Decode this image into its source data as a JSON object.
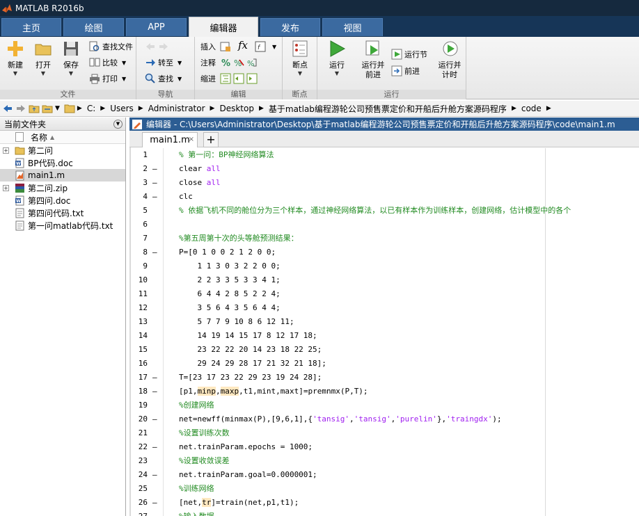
{
  "window": {
    "title": "MATLAB R2016b"
  },
  "tabs": [
    {
      "label": "主页",
      "active": false
    },
    {
      "label": "绘图",
      "active": false
    },
    {
      "label": "APP",
      "active": false
    },
    {
      "label": "编辑器",
      "active": true
    },
    {
      "label": "发布",
      "active": false
    },
    {
      "label": "视图",
      "active": false
    }
  ],
  "ribbon": {
    "file": {
      "group_label": "文件",
      "new": "新建",
      "open": "打开",
      "save": "保存",
      "find_files": "查找文件",
      "compare": "比较",
      "print": "打印"
    },
    "navigate": {
      "group_label": "导航",
      "goto": "转至",
      "find": "查找"
    },
    "edit": {
      "group_label": "编辑",
      "insert": "插入",
      "comment": "注释",
      "indent": "缩进",
      "fx": "fx"
    },
    "breakpoints": {
      "group_label": "断点",
      "breakpoints": "断点"
    },
    "run": {
      "group_label": "运行",
      "run": "运行",
      "run_advance_1": "运行并",
      "run_advance_2": "前进",
      "run_section": "运行节",
      "advance": "前进",
      "run_time_1": "运行并",
      "run_time_2": "计时"
    }
  },
  "address": {
    "crumbs": [
      "C:",
      "Users",
      "Administrator",
      "Desktop",
      "基于matlab编程游轮公司预售票定价和开船后升舱方案源码程序",
      "code"
    ]
  },
  "current_folder": {
    "title": "当前文件夹",
    "column_name": "名称",
    "files": [
      {
        "name": "第二问",
        "type": "folder",
        "expandable": true,
        "selected": false
      },
      {
        "name": "BP代码.doc",
        "type": "doc",
        "expandable": false,
        "selected": false
      },
      {
        "name": "main1.m",
        "type": "m",
        "expandable": false,
        "selected": true
      },
      {
        "name": "第二问.zip",
        "type": "zip",
        "expandable": true,
        "selected": false
      },
      {
        "name": "第四问.doc",
        "type": "doc",
        "expandable": false,
        "selected": false
      },
      {
        "name": "第四问代码.txt",
        "type": "txt",
        "expandable": false,
        "selected": false
      },
      {
        "name": "第一问matlab代码.txt",
        "type": "txt",
        "expandable": false,
        "selected": false
      }
    ]
  },
  "editor": {
    "title": "编辑器 - C:\\Users\\Administrator\\Desktop\\基于matlab编程游轮公司预售票定价和开船后升舱方案源码程序\\code\\main1.m",
    "tab_label": "main1.m",
    "tab_close": "×",
    "new_tab": "+",
    "lines": [
      {
        "n": "1",
        "dash": "",
        "segs": [
          {
            "t": "% 第一问：BP神经网络算法",
            "c": "com"
          }
        ]
      },
      {
        "n": "2",
        "dash": "–",
        "segs": [
          {
            "t": "clear ",
            "c": ""
          },
          {
            "t": "all",
            "c": "str"
          }
        ]
      },
      {
        "n": "3",
        "dash": "–",
        "segs": [
          {
            "t": "close ",
            "c": ""
          },
          {
            "t": "all",
            "c": "str"
          }
        ]
      },
      {
        "n": "4",
        "dash": "–",
        "segs": [
          {
            "t": "clc",
            "c": ""
          }
        ]
      },
      {
        "n": "5",
        "dash": "",
        "segs": [
          {
            "t": "% 依据飞机不同的舱位分为三个样本，通过神经网络算法，以已有样本作为训练样本，创建网络，估计模型中的各个",
            "c": "com"
          }
        ]
      },
      {
        "n": "6",
        "dash": "",
        "segs": [
          {
            "t": "",
            "c": ""
          }
        ]
      },
      {
        "n": "7",
        "dash": "",
        "segs": [
          {
            "t": "%第五周第十次的头等舱预测结果：",
            "c": "com"
          }
        ]
      },
      {
        "n": "8",
        "dash": "–",
        "segs": [
          {
            "t": "P=[0 1 0 0 2 1 2 0 0;",
            "c": ""
          }
        ]
      },
      {
        "n": "9",
        "dash": "",
        "segs": [
          {
            "t": "    1 1 3 0 3 2 2 0 0;",
            "c": ""
          }
        ]
      },
      {
        "n": "10",
        "dash": "",
        "segs": [
          {
            "t": "    2 2 3 3 5 3 3 4 1;",
            "c": ""
          }
        ]
      },
      {
        "n": "11",
        "dash": "",
        "segs": [
          {
            "t": "    6 4 4 2 8 5 2 2 4;",
            "c": ""
          }
        ]
      },
      {
        "n": "12",
        "dash": "",
        "segs": [
          {
            "t": "    3 5 6 4 3 5 6 4 4;",
            "c": ""
          }
        ]
      },
      {
        "n": "13",
        "dash": "",
        "segs": [
          {
            "t": "    5 7 7 9 10 8 6 12 11;",
            "c": ""
          }
        ]
      },
      {
        "n": "14",
        "dash": "",
        "segs": [
          {
            "t": "    14 19 14 15 17 8 12 17 18;",
            "c": ""
          }
        ]
      },
      {
        "n": "15",
        "dash": "",
        "segs": [
          {
            "t": "    23 22 22 20 14 23 18 22 25;",
            "c": ""
          }
        ]
      },
      {
        "n": "16",
        "dash": "",
        "segs": [
          {
            "t": "    29 24 29 28 17 21 32 21 18];",
            "c": ""
          }
        ]
      },
      {
        "n": "17",
        "dash": "–",
        "segs": [
          {
            "t": "T=[23 17 23 22 29 23 19 24 28];",
            "c": ""
          }
        ]
      },
      {
        "n": "18",
        "dash": "–",
        "segs": [
          {
            "t": "[p1,",
            "c": ""
          },
          {
            "t": "minp",
            "c": "hl"
          },
          {
            "t": ",",
            "c": ""
          },
          {
            "t": "maxp",
            "c": "hl"
          },
          {
            "t": ",t1,mint,maxt]=premnmx(P,T);",
            "c": ""
          }
        ]
      },
      {
        "n": "19",
        "dash": "",
        "segs": [
          {
            "t": "%创建网络",
            "c": "com"
          }
        ]
      },
      {
        "n": "20",
        "dash": "–",
        "segs": [
          {
            "t": "net=newff(minmax(P),[9,6,1],{",
            "c": ""
          },
          {
            "t": "'tansig'",
            "c": "str"
          },
          {
            "t": ",",
            "c": ""
          },
          {
            "t": "'tansig'",
            "c": "str"
          },
          {
            "t": ",",
            "c": ""
          },
          {
            "t": "'purelin'",
            "c": "str"
          },
          {
            "t": "},",
            "c": ""
          },
          {
            "t": "'traingdx'",
            "c": "str"
          },
          {
            "t": ");",
            "c": ""
          }
        ]
      },
      {
        "n": "21",
        "dash": "",
        "segs": [
          {
            "t": "%设置训练次数",
            "c": "com"
          }
        ]
      },
      {
        "n": "22",
        "dash": "–",
        "segs": [
          {
            "t": "net.trainParam.epochs = 1000;",
            "c": ""
          }
        ]
      },
      {
        "n": "23",
        "dash": "",
        "segs": [
          {
            "t": "%设置收敛误差",
            "c": "com"
          }
        ]
      },
      {
        "n": "24",
        "dash": "–",
        "segs": [
          {
            "t": "net.trainParam.goal=0.0000001;",
            "c": ""
          }
        ]
      },
      {
        "n": "25",
        "dash": "",
        "segs": [
          {
            "t": "%训练网络",
            "c": "com"
          }
        ]
      },
      {
        "n": "26",
        "dash": "–",
        "segs": [
          {
            "t": "[net,",
            "c": ""
          },
          {
            "t": "tr",
            "c": "hl"
          },
          {
            "t": "]=train(net,p1,t1);",
            "c": ""
          }
        ]
      },
      {
        "n": "27",
        "dash": "",
        "segs": [
          {
            "t": "%输入数据",
            "c": "com"
          }
        ]
      }
    ]
  },
  "colors": {
    "title_bar": "#15293e",
    "tab_bar": "#163557",
    "tab_inactive": "#3b6aa0",
    "editor_title": "#2c5d93",
    "comment": "#228b22",
    "string": "#a020f0"
  }
}
